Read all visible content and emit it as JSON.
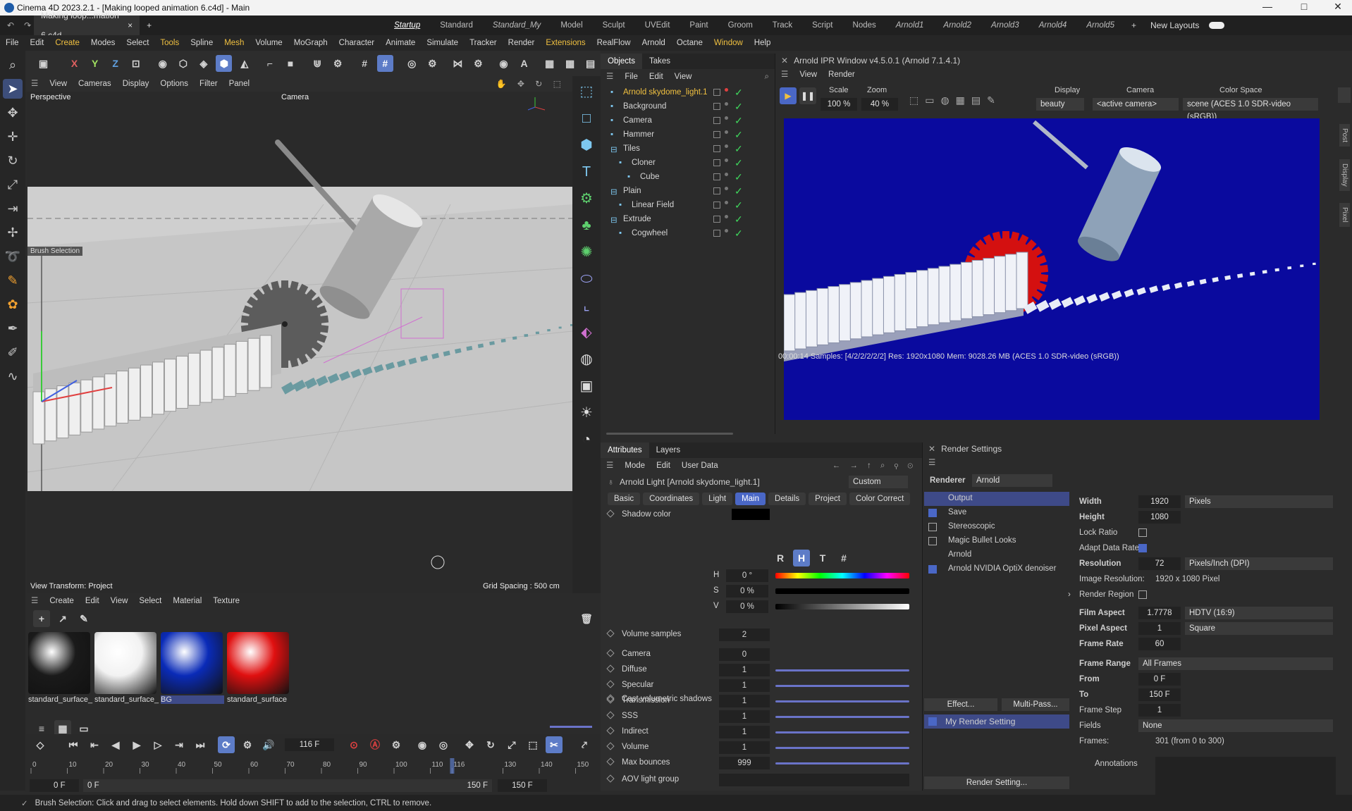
{
  "window": {
    "title": "Cinema 4D 2023.2.1 - [Making looped animation 6.c4d] - Main",
    "min": "—",
    "max": "□",
    "close": "✕"
  },
  "tabs": {
    "doc": "Making loop...mation 6.c4d",
    "close": "×",
    "add": "+"
  },
  "layouts": [
    "Startup",
    "Standard",
    "Standard_My",
    "Model",
    "Sculpt",
    "UVEdit",
    "Paint",
    "Groom",
    "Track",
    "Script",
    "Nodes",
    "Arnold1",
    "Arnold2",
    "Arnold3",
    "Arnold4",
    "Arnold5"
  ],
  "new_layouts": "New Layouts",
  "menu": [
    "File",
    "Edit",
    "Create",
    "Modes",
    "Select",
    "Tools",
    "Spline",
    "Mesh",
    "Volume",
    "MoGraph",
    "Character",
    "Animate",
    "Simulate",
    "Tracker",
    "Render",
    "Extensions",
    "RealFlow",
    "Arnold",
    "Octane",
    "Window",
    "Help"
  ],
  "axis_buttons": [
    "X",
    "Y",
    "Z"
  ],
  "viewport": {
    "menu": [
      "View",
      "Cameras",
      "Display",
      "Options",
      "Filter",
      "Panel"
    ],
    "label": "Perspective",
    "camera": "Camera",
    "brush_tag": "Brush Selection",
    "transform": "View Transform: Project",
    "grid": "Grid Spacing : 500 cm"
  },
  "objects": {
    "tabs": [
      "Objects",
      "Takes"
    ],
    "menu": [
      "File",
      "Edit",
      "View"
    ],
    "items": [
      {
        "name": "Arnold skydome_light.1",
        "indent": 0,
        "highlight": true
      },
      {
        "name": "Background",
        "indent": 0
      },
      {
        "name": "Camera",
        "indent": 0
      },
      {
        "name": "Hammer",
        "indent": 0
      },
      {
        "name": "Tiles",
        "indent": 0
      },
      {
        "name": "Cloner",
        "indent": 1
      },
      {
        "name": "Cube",
        "indent": 2
      },
      {
        "name": "Plain",
        "indent": 0
      },
      {
        "name": "Linear Field",
        "indent": 1
      },
      {
        "name": "Extrude",
        "indent": 0
      },
      {
        "name": "Cogwheel",
        "indent": 1
      }
    ]
  },
  "ipr": {
    "title": "Arnold IPR Window v4.5.0.1 (Arnold 7.1.4.1)",
    "menu": [
      "View",
      "Render"
    ],
    "scale_label": "Scale",
    "scale": "100 %",
    "zoom_label": "Zoom",
    "zoom": "40 %",
    "display_label": "Display",
    "display": "beauty",
    "camera_label": "Camera",
    "camera": "<active camera>",
    "colorspace_label": "Color Space",
    "colorspace": "scene (ACES 1.0 SDR-video (sRGB))",
    "status": "00:00:14  Samples: [4/2/2/2/2/2]  Res: 1920x1080  Mem: 9028.26 MB  (ACES 1.0 SDR-video (sRGB))",
    "side_tabs": [
      "Post",
      "Display",
      "Pixel"
    ]
  },
  "attributes": {
    "tabs": [
      "Attributes",
      "Layers"
    ],
    "menu": [
      "Mode",
      "Edit",
      "User Data"
    ],
    "object": "Arnold Light [Arnold skydome_light.1]",
    "preset": "Custom",
    "subtabs": [
      "Basic",
      "Coordinates",
      "Light",
      "Main",
      "Details",
      "Project",
      "Color Correct"
    ],
    "shadow_color": "Shadow color",
    "hsv": [
      {
        "k": "H",
        "v": "0 °"
      },
      {
        "k": "S",
        "v": "0 %"
      },
      {
        "k": "V",
        "v": "0 %"
      }
    ],
    "color_modes": [
      "R",
      "H",
      "T",
      "#"
    ],
    "cast_vol": "Cast volumetric shadows",
    "params": [
      {
        "name": "Volume samples",
        "value": "2"
      },
      {
        "name": "Camera",
        "value": "0"
      },
      {
        "name": "Diffuse",
        "value": "1"
      },
      {
        "name": "Specular",
        "value": "1"
      },
      {
        "name": "Transmission",
        "value": "1"
      },
      {
        "name": "SSS",
        "value": "1"
      },
      {
        "name": "Indirect",
        "value": "1"
      },
      {
        "name": "Volume",
        "value": "1"
      },
      {
        "name": "Max bounces",
        "value": "999"
      },
      {
        "name": "AOV light group",
        "value": ""
      }
    ]
  },
  "render_settings": {
    "title": "Render Settings",
    "renderer_label": "Renderer",
    "renderer": "Arnold",
    "list": [
      {
        "name": "Output",
        "check": false,
        "selected": true
      },
      {
        "name": "Save",
        "check": true
      },
      {
        "name": "Stereoscopic",
        "check": false
      },
      {
        "name": "Magic Bullet Looks",
        "check": false
      },
      {
        "name": "Arnold",
        "check": null
      },
      {
        "name": "Arnold NVIDIA OptiX denoiser",
        "check": true
      }
    ],
    "effect_btn": "Effect...",
    "multipass_btn": "Multi-Pass...",
    "setting_name": "My Render Setting",
    "bottom_btn": "Render Setting...",
    "width_label": "Width",
    "width": "1920",
    "units": "Pixels",
    "height_label": "Height",
    "height": "1080",
    "lock_ratio": "Lock Ratio",
    "adapt": "Adapt Data Rate",
    "resolution_label": "Resolution",
    "resolution": "72",
    "res_units": "Pixels/Inch (DPI)",
    "image_res_label": "Image Resolution:",
    "image_res": "1920 x 1080 Pixel",
    "render_region": "Render Region",
    "film_aspect_label": "Film Aspect",
    "film_aspect": "1.7778",
    "film_aspect_dd": "HDTV (16:9)",
    "pixel_aspect_label": "Pixel Aspect",
    "pixel_aspect": "1",
    "pixel_aspect_dd": "Square",
    "frame_rate_label": "Frame Rate",
    "frame_rate": "60",
    "frame_range_label": "Frame Range",
    "frame_range": "All Frames",
    "from_label": "From",
    "from": "0 F",
    "to_label": "To",
    "to": "150 F",
    "frame_step_label": "Frame Step",
    "frame_step": "1",
    "fields_label": "Fields",
    "fields": "None",
    "frames_label": "Frames:",
    "frames": "301 (from 0 to 300)",
    "annotations": "Annotations"
  },
  "materials": {
    "menu": [
      "Create",
      "Edit",
      "View",
      "Select",
      "Material",
      "Texture"
    ],
    "items": [
      {
        "name": "standard_surface_",
        "color": "#1a1a1a"
      },
      {
        "name": "standard_surface_",
        "color": "#f2f2f2"
      },
      {
        "name": "BG",
        "color": "#0a2bb8"
      },
      {
        "name": "standard_surface",
        "color": "#e01010"
      }
    ]
  },
  "timeline": {
    "current_frame": "116 F",
    "ticks": [
      "0",
      "10",
      "20",
      "30",
      "40",
      "50",
      "60",
      "70",
      "80",
      "90",
      "100",
      "110",
      "116",
      "130",
      "140",
      "150"
    ],
    "start": "0 F",
    "start2": "0 F",
    "end": "150 F",
    "end2": "150 F"
  },
  "status": "Brush Selection: Click and drag to select elements. Hold down SHIFT to add to the selection, CTRL to remove."
}
